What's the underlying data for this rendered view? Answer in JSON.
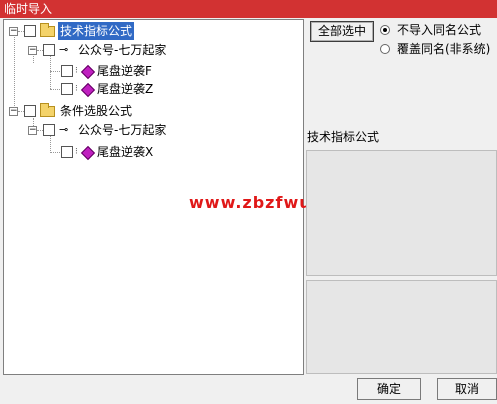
{
  "window": {
    "title": "临时导入"
  },
  "tree": {
    "nodes": [
      {
        "label": "技术指标公式",
        "selected": true
      },
      {
        "label": "公众号-七万起家"
      },
      {
        "label": "尾盘逆袭F"
      },
      {
        "label": "尾盘逆袭Z"
      },
      {
        "label": "条件选股公式"
      },
      {
        "label": "公众号-七万起家"
      },
      {
        "label": "尾盘逆袭X"
      }
    ],
    "expander_symbol": "−"
  },
  "buttons": {
    "select_all": "全部选中",
    "ok": "确定",
    "cancel": "取消"
  },
  "options": {
    "no_import_same": "不导入同名公式",
    "overwrite_same": "覆盖同名(非系统)",
    "selected_option": "no_import_same"
  },
  "detail": {
    "category_label": "技术指标公式"
  },
  "watermark": "www.zbzfwu.com",
  "colors": {
    "titlebar": "#d23232",
    "selection": "#316ac5",
    "watermark": "#e01818",
    "formula_icon": "#c020c0"
  }
}
